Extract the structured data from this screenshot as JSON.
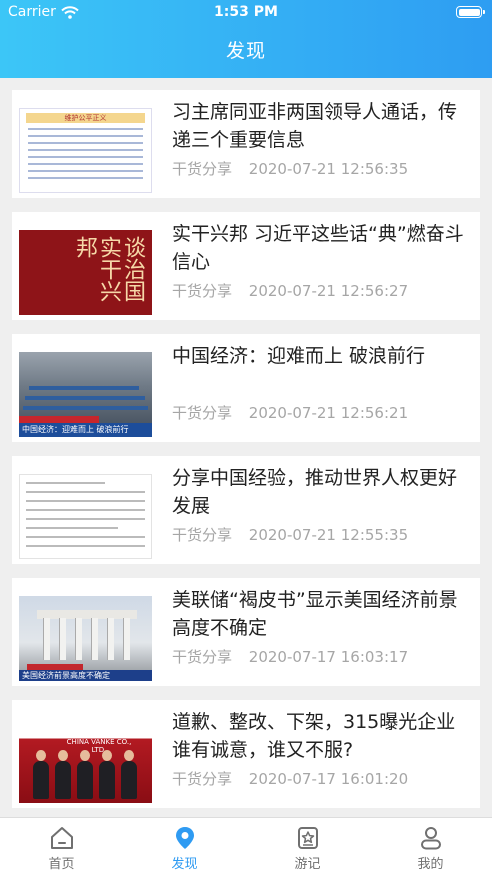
{
  "status_bar": {
    "carrier": "Carrier",
    "time": "1:53 PM"
  },
  "header": {
    "title": "发现"
  },
  "articles": [
    {
      "title": "习主席同亚非两国领导人通话，传递三个重要信息",
      "source": "干货分享",
      "time": "2020-07-21 12:56:35",
      "thumb_text": "维护公平正义"
    },
    {
      "title": "实干兴邦 习近平这些话“典”燃奋斗信心",
      "source": "干货分享",
      "time": "2020-07-21 12:56:27",
      "thumb_text": "谈治国 实干兴邦"
    },
    {
      "title": "中国经济：迎难而上 破浪前行",
      "source": "干货分享",
      "time": "2020-07-21 12:56:21",
      "thumb_text": "中国经济：迎难而上 破浪前行"
    },
    {
      "title": "分享中国经验，推动世界人权更好发展",
      "source": "干货分享",
      "time": "2020-07-21 12:55:35",
      "thumb_text": ""
    },
    {
      "title": "美联储“褐皮书”显示美国经济前景高度不确定",
      "source": "干货分享",
      "time": "2020-07-17 16:03:17",
      "thumb_text": "美国经济前景高度不确定"
    },
    {
      "title": "道歉、整改、下架，315曝光企业谁有诚意，谁又不服?",
      "source": "干货分享",
      "time": "2020-07-17 16:01:20",
      "thumb_text": "万科企业股份有限公司 CHINA VANKE CO., LTD."
    }
  ],
  "tabs": [
    {
      "label": "首页",
      "icon": "home-icon"
    },
    {
      "label": "发现",
      "icon": "location-pin-icon",
      "active": true
    },
    {
      "label": "游记",
      "icon": "travel-notes-icon"
    },
    {
      "label": "我的",
      "icon": "profile-icon"
    }
  ],
  "colors": {
    "accent": "#2f9bf2",
    "header_start": "#3cc6f7",
    "header_end": "#2e9df2",
    "meta": "#a6a6a6"
  }
}
